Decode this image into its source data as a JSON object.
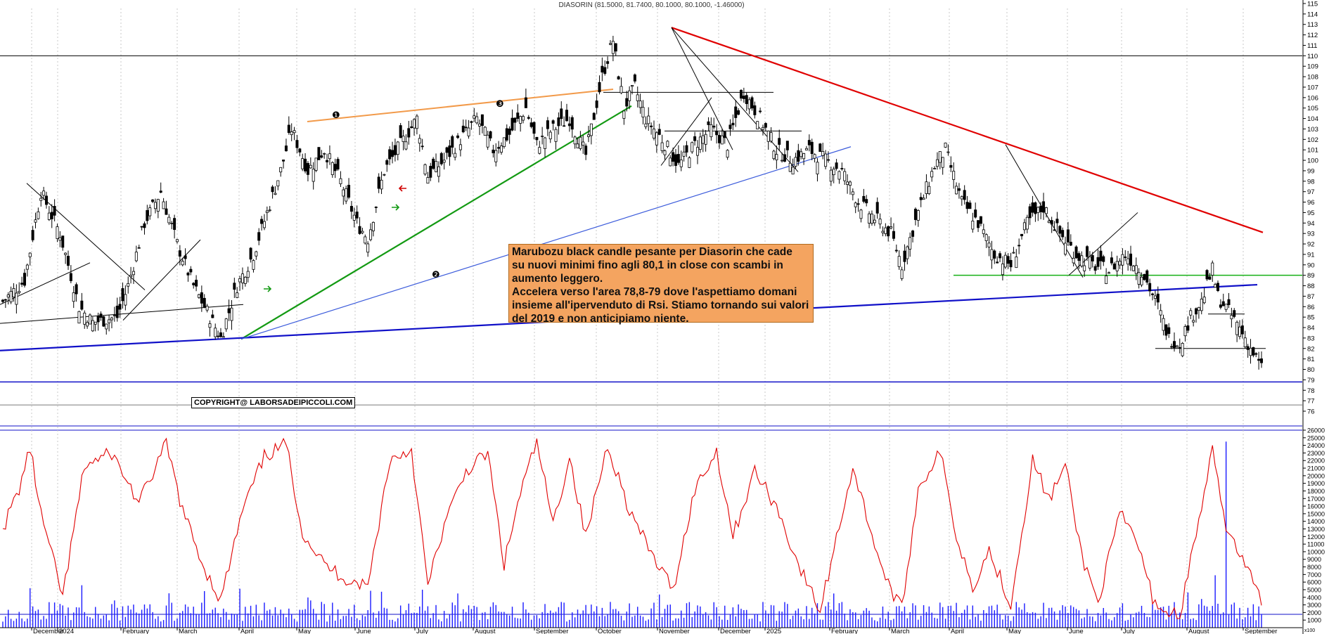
{
  "chart_data": [
    {
      "type": "candlestick",
      "title": "DIASORIN (81.5000, 81.7400, 80.1000, 80.1000, -1.46000)",
      "ylim": [
        76,
        115
      ],
      "y_ticks": [
        76,
        77,
        78,
        79,
        80,
        81,
        82,
        83,
        84,
        85,
        86,
        87,
        88,
        89,
        90,
        91,
        92,
        93,
        94,
        95,
        96,
        97,
        98,
        99,
        100,
        101,
        102,
        103,
        104,
        105,
        106,
        107,
        108,
        109,
        110,
        111,
        112,
        113,
        114,
        115
      ],
      "x_tick_labels": [
        "December",
        "2024",
        "February",
        "March",
        "April",
        "May",
        "June",
        "July",
        "August",
        "September",
        "October",
        "November",
        "December",
        "2025",
        "February",
        "March",
        "April",
        "May",
        "June",
        "July",
        "August",
        "September"
      ],
      "grid": true,
      "close_path": [
        {
          "t": 0,
          "y": 86.5
        },
        {
          "t": 8,
          "y": 88.5
        },
        {
          "t": 14,
          "y": 97
        },
        {
          "t": 21,
          "y": 93
        },
        {
          "t": 28,
          "y": 86
        },
        {
          "t": 33,
          "y": 84.5
        },
        {
          "t": 42,
          "y": 85
        },
        {
          "t": 46,
          "y": 88
        },
        {
          "t": 52,
          "y": 94
        },
        {
          "t": 58,
          "y": 97
        },
        {
          "t": 64,
          "y": 92
        },
        {
          "t": 70,
          "y": 88
        },
        {
          "t": 76,
          "y": 85
        },
        {
          "t": 80,
          "y": 83
        },
        {
          "t": 86,
          "y": 88
        },
        {
          "t": 92,
          "y": 91
        },
        {
          "t": 97,
          "y": 95
        },
        {
          "t": 102,
          "y": 99
        },
        {
          "t": 106,
          "y": 103
        },
        {
          "t": 112,
          "y": 99
        },
        {
          "t": 118,
          "y": 101
        },
        {
          "t": 124,
          "y": 98
        },
        {
          "t": 130,
          "y": 94
        },
        {
          "t": 134,
          "y": 92.5
        },
        {
          "t": 140,
          "y": 99
        },
        {
          "t": 146,
          "y": 101.5
        },
        {
          "t": 152,
          "y": 104
        },
        {
          "t": 156,
          "y": 98.5
        },
        {
          "t": 162,
          "y": 100
        },
        {
          "t": 168,
          "y": 102
        },
        {
          "t": 174,
          "y": 104
        },
        {
          "t": 180,
          "y": 101
        },
        {
          "t": 186,
          "y": 102.5
        },
        {
          "t": 192,
          "y": 105
        },
        {
          "t": 196,
          "y": 101.5
        },
        {
          "t": 202,
          "y": 103
        },
        {
          "t": 208,
          "y": 104
        },
        {
          "t": 214,
          "y": 100.5
        },
        {
          "t": 220,
          "y": 108
        },
        {
          "t": 224,
          "y": 111.5
        },
        {
          "t": 228,
          "y": 105
        },
        {
          "t": 232,
          "y": 107
        },
        {
          "t": 236,
          "y": 104
        },
        {
          "t": 242,
          "y": 102
        },
        {
          "t": 248,
          "y": 99.5
        },
        {
          "t": 254,
          "y": 101.5
        },
        {
          "t": 260,
          "y": 103
        },
        {
          "t": 266,
          "y": 101.5
        },
        {
          "t": 272,
          "y": 106.5
        },
        {
          "t": 278,
          "y": 104
        },
        {
          "t": 284,
          "y": 101
        },
        {
          "t": 290,
          "y": 100
        },
        {
          "t": 296,
          "y": 101
        },
        {
          "t": 302,
          "y": 100
        },
        {
          "t": 308,
          "y": 99
        },
        {
          "t": 314,
          "y": 96
        },
        {
          "t": 320,
          "y": 94.5
        },
        {
          "t": 326,
          "y": 93
        },
        {
          "t": 330,
          "y": 90
        },
        {
          "t": 336,
          "y": 95
        },
        {
          "t": 342,
          "y": 99.5
        },
        {
          "t": 346,
          "y": 101
        },
        {
          "t": 352,
          "y": 96
        },
        {
          "t": 358,
          "y": 94
        },
        {
          "t": 364,
          "y": 91
        },
        {
          "t": 370,
          "y": 90
        },
        {
          "t": 376,
          "y": 94
        },
        {
          "t": 382,
          "y": 95.5
        },
        {
          "t": 388,
          "y": 93
        },
        {
          "t": 394,
          "y": 91
        },
        {
          "t": 400,
          "y": 90
        },
        {
          "t": 406,
          "y": 89.5
        },
        {
          "t": 412,
          "y": 91
        },
        {
          "t": 418,
          "y": 89.5
        },
        {
          "t": 424,
          "y": 86
        },
        {
          "t": 428,
          "y": 83
        },
        {
          "t": 432,
          "y": 82.5
        },
        {
          "t": 436,
          "y": 85
        },
        {
          "t": 440,
          "y": 86.5
        },
        {
          "t": 444,
          "y": 89.5
        },
        {
          "t": 446,
          "y": 87
        },
        {
          "t": 450,
          "y": 85.5
        },
        {
          "t": 454,
          "y": 84
        },
        {
          "t": 458,
          "y": 82
        },
        {
          "t": 462,
          "y": 80.1
        }
      ],
      "volume_ylim": [
        0,
        26000
      ],
      "volume_ticks": [
        1000,
        2000,
        3000,
        4000,
        5000,
        6000,
        7000,
        8000,
        9000,
        10000,
        11000,
        12000,
        13000,
        14000,
        15000,
        16000,
        17000,
        18000,
        19000,
        20000,
        21000,
        22000,
        23000,
        24000,
        25000,
        26000
      ],
      "volume_unit": "x100",
      "rsi_path": [
        {
          "t": 0,
          "y": 0.5
        },
        {
          "t": 6,
          "y": 0.72
        },
        {
          "t": 10,
          "y": 0.95
        },
        {
          "t": 14,
          "y": 0.58
        },
        {
          "t": 22,
          "y": 0.12
        },
        {
          "t": 30,
          "y": 0.85
        },
        {
          "t": 40,
          "y": 0.92
        },
        {
          "t": 50,
          "y": 0.64
        },
        {
          "t": 60,
          "y": 0.97
        },
        {
          "t": 66,
          "y": 0.6
        },
        {
          "t": 74,
          "y": 0.28
        },
        {
          "t": 80,
          "y": 0.1
        },
        {
          "t": 88,
          "y": 0.6
        },
        {
          "t": 96,
          "y": 0.9
        },
        {
          "t": 104,
          "y": 0.97
        },
        {
          "t": 110,
          "y": 0.48
        },
        {
          "t": 118,
          "y": 0.3
        },
        {
          "t": 126,
          "y": 0.22
        },
        {
          "t": 134,
          "y": 0.18
        },
        {
          "t": 142,
          "y": 0.88
        },
        {
          "t": 150,
          "y": 0.94
        },
        {
          "t": 156,
          "y": 0.18
        },
        {
          "t": 162,
          "y": 0.52
        },
        {
          "t": 170,
          "y": 0.82
        },
        {
          "t": 178,
          "y": 0.92
        },
        {
          "t": 184,
          "y": 0.3
        },
        {
          "t": 190,
          "y": 0.7
        },
        {
          "t": 196,
          "y": 0.98
        },
        {
          "t": 202,
          "y": 0.52
        },
        {
          "t": 208,
          "y": 0.9
        },
        {
          "t": 214,
          "y": 0.45
        },
        {
          "t": 222,
          "y": 0.97
        },
        {
          "t": 230,
          "y": 0.6
        },
        {
          "t": 238,
          "y": 0.36
        },
        {
          "t": 246,
          "y": 0.16
        },
        {
          "t": 254,
          "y": 0.72
        },
        {
          "t": 262,
          "y": 0.93
        },
        {
          "t": 268,
          "y": 0.46
        },
        {
          "t": 276,
          "y": 0.82
        },
        {
          "t": 284,
          "y": 0.62
        },
        {
          "t": 292,
          "y": 0.3
        },
        {
          "t": 300,
          "y": 0.04
        },
        {
          "t": 306,
          "y": 0.45
        },
        {
          "t": 312,
          "y": 0.84
        },
        {
          "t": 318,
          "y": 0.52
        },
        {
          "t": 324,
          "y": 0.22
        },
        {
          "t": 330,
          "y": 0.05
        },
        {
          "t": 336,
          "y": 0.72
        },
        {
          "t": 344,
          "y": 0.93
        },
        {
          "t": 350,
          "y": 0.46
        },
        {
          "t": 356,
          "y": 0.18
        },
        {
          "t": 362,
          "y": 0.38
        },
        {
          "t": 370,
          "y": 0.08
        },
        {
          "t": 378,
          "y": 0.88
        },
        {
          "t": 384,
          "y": 0.66
        },
        {
          "t": 390,
          "y": 0.85
        },
        {
          "t": 396,
          "y": 0.35
        },
        {
          "t": 402,
          "y": 0.09
        },
        {
          "t": 410,
          "y": 0.58
        },
        {
          "t": 416,
          "y": 0.44
        },
        {
          "t": 422,
          "y": 0.12
        },
        {
          "t": 426,
          "y": 0.04
        },
        {
          "t": 432,
          "y": 0.02
        },
        {
          "t": 440,
          "y": 0.62
        },
        {
          "t": 444,
          "y": 0.93
        },
        {
          "t": 448,
          "y": 0.56
        },
        {
          "t": 452,
          "y": 0.42
        },
        {
          "t": 456,
          "y": 0.3
        },
        {
          "t": 462,
          "y": 0.1
        }
      ],
      "annotations": [
        "❶",
        "❷",
        "❸"
      ]
    }
  ],
  "note": {
    "lines": [
      "Marubozu black candle pesante per Diasorin che cade",
      "su nuovi minimi fino agli 80,1 in close con scambi in",
      "aumento leggero.",
      "Accelera verso l'area 78,8-79 dove l'aspettiamo domani",
      "insieme all'ipervenduto di Rsi. Stiamo tornando sui valori",
      "del 2019 e non anticipiamo niente."
    ]
  },
  "copyright": "COPYRIGHT@ LABORSADEIPICCOLI.COM",
  "colors": {
    "candle": "#000000",
    "red_trendline": "#e00000",
    "orange_trendline": "#f29a4a",
    "green_trendline": "#139a13",
    "blue_support": "#1010c8",
    "thin_blue": "#3b5bdb",
    "rsi": "#e00000",
    "volume": "#1a1aff",
    "grid": "#c8c8c8",
    "note_bg": "#f4a460"
  }
}
